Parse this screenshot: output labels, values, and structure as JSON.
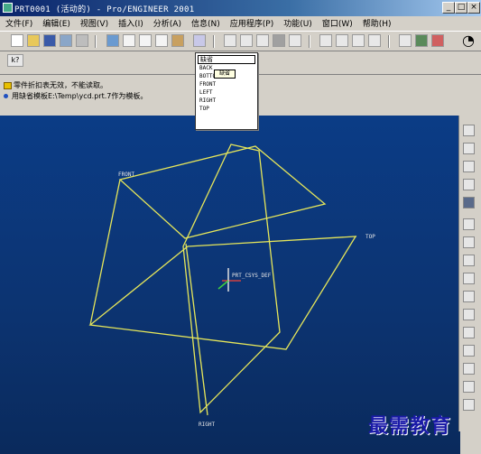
{
  "window": {
    "title": "PRT0001 (活动的) - Pro/ENGINEER 2001",
    "minimize_glyph": "_",
    "maximize_glyph": "□",
    "close_glyph": "×"
  },
  "menubar": {
    "items": [
      "文件(F)",
      "编辑(E)",
      "视图(V)",
      "插入(I)",
      "分析(A)",
      "信息(N)",
      "应用程序(P)",
      "功能(U)",
      "窗口(W)",
      "帮助(H)"
    ]
  },
  "help_button_label": "k?",
  "messages": [
    {
      "text": "零件折扣表无效，不能读取。",
      "icon": "warning-icon"
    },
    {
      "text": "用缺省模板E:\\Temp\\ycd.prt.7作为模板。",
      "icon": "bullet-icon"
    }
  ],
  "view_dropdown": {
    "selected": "缺省",
    "tooltip": "缺省",
    "options": [
      "BACK",
      "BOTTOM",
      "FRONT",
      "LEFT",
      "RIGHT",
      "TOP"
    ]
  },
  "viewport": {
    "plane_labels": {
      "front": "FRONT",
      "top": "TOP",
      "right": "RIGHT"
    },
    "csys_label": "PRT_CSYS_DEF",
    "plane_color": "#e6e65a",
    "background_color": "#0b3c86"
  },
  "watermark": "最需教育"
}
